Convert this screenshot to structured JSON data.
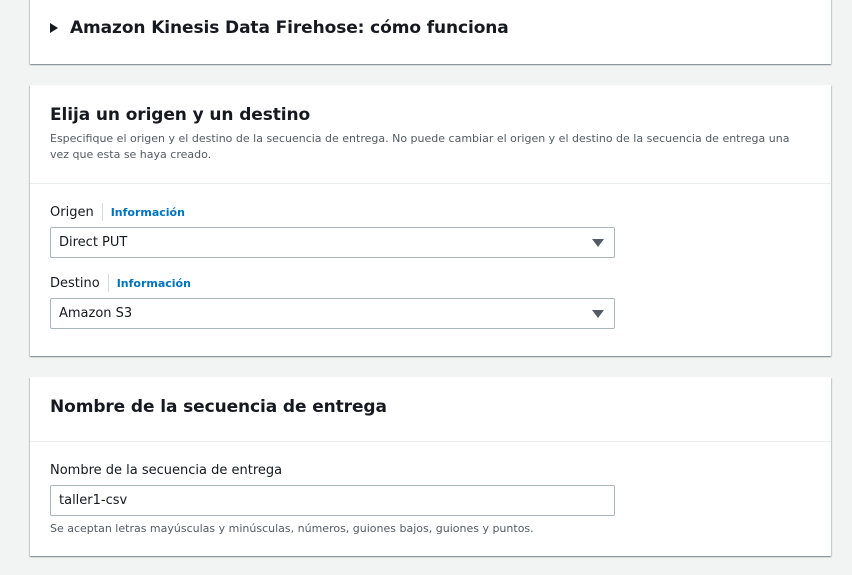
{
  "how_it_works": {
    "title": "Amazon Kinesis Data Firehose: cómo funciona"
  },
  "source_destination": {
    "title": "Elija un origen y un destino",
    "description": "Especifique el origen y el destino de la secuencia de entrega. No puede cambiar el origen y el destino de la secuencia de entrega una vez que esta se haya creado.",
    "source": {
      "label": "Origen",
      "info": "Información",
      "value": "Direct PUT"
    },
    "destination": {
      "label": "Destino",
      "info": "Información",
      "value": "Amazon S3"
    }
  },
  "stream_name": {
    "title": "Nombre de la secuencia de entrega",
    "field_label": "Nombre de la secuencia de entrega",
    "value": "taller1-csv",
    "hint": "Se aceptan letras mayúsculas y minúsculas, números, guiones bajos, guiones y puntos."
  },
  "colors": {
    "link": "#0073bb",
    "background": "#f2f3f3",
    "text": "#16191f"
  }
}
